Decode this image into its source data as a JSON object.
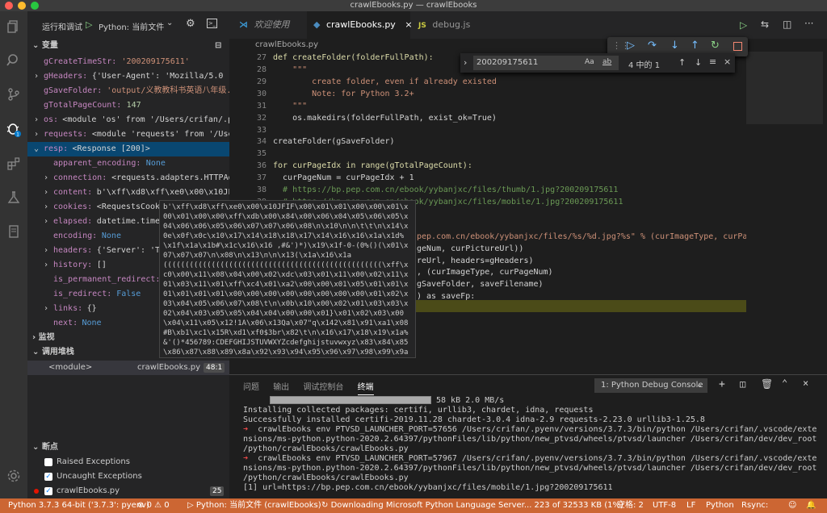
{
  "window_title": "crawlEbooks.py — crawlEbooks",
  "run_toolbar": {
    "run_label": "运行和调试",
    "config": "Python: 当前文件"
  },
  "sidebar": {
    "variables_title": "变量",
    "vars": [
      {
        "name": "gCreateTimeStr:",
        "value": "'200209175611'"
      },
      {
        "name": "gHeaders:",
        "value": "{'User-Agent': 'Mozilla/5.0 (..."
      },
      {
        "name": "gSaveFolder:",
        "value": "'output/义教教科书英语八年级..."
      },
      {
        "name": "gTotalPageCount:",
        "value": "147"
      },
      {
        "name": "os:",
        "value": "<module 'os' from '/Users/crifan/.p..."
      },
      {
        "name": "requests:",
        "value": "<module 'requests' from '/Use..."
      },
      {
        "name": "resp:",
        "value": "<Response [200]>"
      },
      {
        "name": "apparent_encoding:",
        "value": "None"
      },
      {
        "name": "connection:",
        "value": "<requests.adapters.HTTPAda..."
      },
      {
        "name": "content:",
        "value": "b'\\xff\\xd8\\xff\\xe0\\x00\\x10JFI..."
      },
      {
        "name": "cookies:",
        "value": "<RequestsCooki..."
      },
      {
        "name": "elapsed:",
        "value": "datetime.timed..."
      },
      {
        "name": "encoding:",
        "value": "None"
      },
      {
        "name": "headers:",
        "value": "{'Server': 'Te..."
      },
      {
        "name": "history:",
        "value": "[]"
      },
      {
        "name": "is_permanent_redirect:",
        "value": ""
      },
      {
        "name": "is_redirect:",
        "value": "False"
      },
      {
        "name": "links:",
        "value": "{}"
      },
      {
        "name": "next:",
        "value": "None"
      }
    ],
    "watch_title": "监视",
    "callstack_title": "调用堆栈",
    "callstack_frame": "<module>",
    "callstack_file": "crawlEbooks.py",
    "callstack_line": "48:1",
    "breakpoints_title": "断点",
    "bp_raised": "Raised Exceptions",
    "bp_uncaught": "Uncaught Exceptions",
    "bp_file": "crawlEbooks.py",
    "bp_file_count": "25"
  },
  "tabs": [
    {
      "label": "欢迎使用"
    },
    {
      "label": "crawlEbooks.py"
    },
    {
      "label": "debug.js"
    }
  ],
  "breadcrumb": "crawlEbooks.py",
  "find": {
    "value": "200209175611",
    "count": "4 中的 1"
  },
  "code_lines": [
    {
      "n": "27",
      "t": "def createFolder(folderFullPath):"
    },
    {
      "n": "28",
      "t": "    \"\"\""
    },
    {
      "n": "29",
      "t": "        create folder, even if already existed"
    },
    {
      "n": "30",
      "t": "        Note: for Python 3.2+"
    },
    {
      "n": "31",
      "t": "    \"\"\""
    },
    {
      "n": "32",
      "t": "    os.makedirs(folderFullPath, exist_ok=True)"
    },
    {
      "n": "33",
      "t": ""
    },
    {
      "n": "34",
      "t": "createFolder(gSaveFolder)"
    },
    {
      "n": "35",
      "t": ""
    },
    {
      "n": "36",
      "t": "for curPageIdx in range(gTotalPageCount):"
    },
    {
      "n": "37",
      "t": "  curPageNum = curPageIdx + 1"
    },
    {
      "n": "38",
      "t": "  # https://bp.pep.com.cn/ebook/yybanjxc/files/thumb/1.jpg?200209175611"
    },
    {
      "n": "39",
      "t": "  # https://bp.pep.com.cn/ebook/yybanjxc/files/mobile/1.jpg?200209175611"
    }
  ],
  "code_fragments": [
    "pep.com.cn/ebook/yybanjxc/files/%s/%d.jpg?%s\" % (curImageType, curPag",
    "geNum, curPictureUrl))",
    "reUrl, headers=gHeaders)",
    ", (curImageType, curPageNum)",
    "gSaveFolder, saveFilename)",
    ") as saveFp:"
  ],
  "hover_text": "b'\\xff\\xd8\\xff\\xe0\\x00\\x10JFIF\\x00\\x01\\x01\\x00\\x00\\x01\\x00\\x01\\x00\\x00\\xff\\xdb\\x00\\x84\\x00\\x06\\x04\\x05\\x06\\x05\\x04\\x06\\x06\\x05\\x06\\x07\\x07\\x06\\x08\\n\\x10\\n\\n\\t\\t\\n\\x14\\x0e\\x0f\\x0c\\x10\\x17\\x14\\x18\\x18\\x17\\x14\\x16\\x16\\x1a\\x1d%\\x1f\\x1a\\x1b#\\x1c\\x16\\x16 ,#&')*)\\x19\\x1f-0-(0%()(\\x01\\x07\\x07\\x07\\n\\x08\\n\\x13\\n\\n\\x13(\\x1a\\x16\\x1a((((((((((((((((((((((((((((((((((((((((((((((((((\\xff\\xc0\\x00\\x11\\x08\\x04\\x00\\x02\\xdc\\x03\\x01\\x11\\x00\\x02\\x11\\x01\\x03\\x11\\x01\\xff\\xc4\\x01\\xa2\\x00\\x00\\x01\\x05\\x01\\x01\\x01\\x01\\x01\\x01\\x00\\x00\\x00\\x00\\x00\\x00\\x00\\x00\\x01\\x02\\x03\\x04\\x05\\x06\\x07\\x08\\t\\n\\x0b\\x10\\x00\\x02\\x01\\x03\\x03\\x02\\x04\\x03\\x05\\x05\\x04\\x04\\x00\\x00\\x01}\\x01\\x02\\x03\\x00\\x04\\x11\\x05\\x12!1A\\x06\\x13Qa\\x07\"q\\x142\\x81\\x91\\xa1\\x08#B\\xb1\\xc1\\x15R\\xd1\\xf0$3br\\x82\\t\\n\\x16\\x17\\x18\\x19\\x1a%&'()*456789:CDEFGHIJSTUVWXYZcdefghijstuvwxyz\\x83\\x84\\x85\\x86\\x87\\x88\\x89\\x8a\\x92\\x93\\x94\\x95\\x96\\x97\\x98\\x99\\x9a\\xa2\\xa3\\xa4\\xa5\\xa6\\xa7\\xa8\\xa9\\xaa\\xb2\\xb3\\xb4\\xb5\\xb6\\xb7\\xb8\\xb9\\xba\\xc2\\xc3\\xc4\\xc5\\xc6\\xc7\\xc8\\xc9\\xca\\xd2\\xd3\\xd4\\xd5\\xd6\\xd7\\xd8\\xd9",
  "panel": {
    "tabs": [
      "问题",
      "输出",
      "调试控制台",
      "终端"
    ],
    "terminal_select": "1: Python Debug Console",
    "lines": [
      "58 kB 2.0 MB/s",
      "Installing collected packages: certifi, urllib3, chardet, idna, requests",
      "Successfully installed certifi-2019.11.28 chardet-3.0.4 idna-2.9 requests-2.23.0 urllib3-1.25.8",
      "crawlEbooks env PTVSD_LAUNCHER_PORT=57656 /Users/crifan/.pyenv/versions/3.7.3/bin/python /Users/crifan/.vscode/exte",
      "nsions/ms-python.python-2020.2.64397/pythonFiles/lib/python/new_ptvsd/wheels/ptvsd/launcher /Users/crifan/dev/dev_root",
      "/python/crawlEbooks/crawlEbooks.py",
      "crawlEbooks env PTVSD_LAUNCHER_PORT=57967 /Users/crifan/.pyenv/versions/3.7.3/bin/python /Users/crifan/.vscode/exte",
      "nsions/ms-python.python-2020.2.64397/pythonFiles/lib/python/new_ptvsd/wheels/ptvsd/launcher /Users/crifan/dev/dev_root",
      "/python/crawlEbooks/crawlEbooks.py",
      "[1] url=https://bp.pep.com.cn/ebook/yybanjxc/files/mobile/1.jpg?200209175611"
    ]
  },
  "status": {
    "python": "Python 3.7.3 64-bit ('3.7.3': pyenv)",
    "errors": "0",
    "warnings": "0",
    "config": "Python: 当前文件 (crawlEbooks)",
    "download": "Downloading Microsoft Python Language Server... 223 of 32533 KB (1%)",
    "spaces": "空格: 2",
    "encoding": "UTF-8",
    "eol": "LF",
    "lang": "Python",
    "rsync": "Rsync:"
  },
  "colors": {
    "status_bg": "#cc6633",
    "accent": "#007acc"
  }
}
